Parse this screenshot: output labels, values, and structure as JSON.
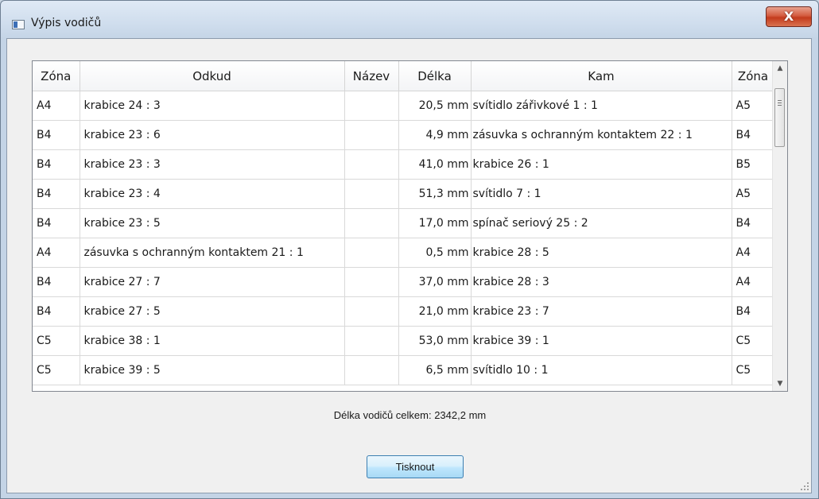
{
  "window": {
    "title": "Výpis vodičů",
    "close_label": "X"
  },
  "table": {
    "columns": [
      "Zóna",
      "Odkud",
      "Název",
      "Délka",
      "Kam",
      "Zóna"
    ],
    "rows": [
      [
        "A4",
        "krabice 24 : 3",
        "",
        "20,5 mm",
        "svítidlo zářivkové 1 : 1",
        "A5"
      ],
      [
        "B4",
        "krabice 23 : 6",
        "",
        "4,9 mm",
        "zásuvka s ochranným kontaktem 22 : 1",
        "B4"
      ],
      [
        "B4",
        "krabice 23 : 3",
        "",
        "41,0 mm",
        "krabice 26 : 1",
        "B5"
      ],
      [
        "B4",
        "krabice 23 : 4",
        "",
        "51,3 mm",
        "svítidlo 7 : 1",
        "A5"
      ],
      [
        "B4",
        "krabice 23 : 5",
        "",
        "17,0 mm",
        "spínač seriový 25 : 2",
        "B4"
      ],
      [
        "A4",
        "zásuvka s ochranným kontaktem 21 : 1",
        "",
        "0,5 mm",
        "krabice 28 : 5",
        "A4"
      ],
      [
        "B4",
        "krabice 27 : 7",
        "",
        "37,0 mm",
        "krabice 28 : 3",
        "A4"
      ],
      [
        "B4",
        "krabice 27 : 5",
        "",
        "21,0 mm",
        "krabice 23 : 7",
        "B4"
      ],
      [
        "C5",
        "krabice 38 : 1",
        "",
        "53,0 mm",
        "krabice 39 : 1",
        "C5"
      ],
      [
        "C5",
        "krabice 39 : 5",
        "",
        "6,5 mm",
        "svítidlo 10 : 1",
        "C5"
      ]
    ]
  },
  "footer": {
    "total_label": "Délka vodičů celkem: 2342,2 mm",
    "print_button": "Tisknout"
  }
}
